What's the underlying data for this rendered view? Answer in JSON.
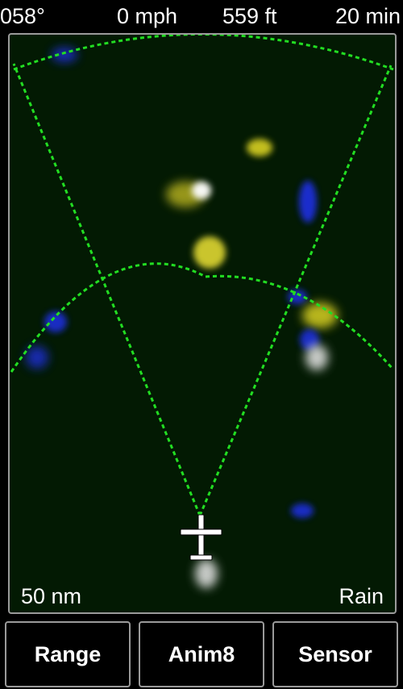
{
  "status": {
    "heading": "058°",
    "speed": "0 mph",
    "altitude": "559 ft",
    "time": "20 min"
  },
  "radar": {
    "range_label": "50 nm",
    "product_label": "Rain",
    "ring_color": "#22dd22",
    "background_color": "#031a03",
    "precip_colors": {
      "light": "#1a2fd8",
      "moderate": "#d8d020",
      "heavy": "#ffffff"
    }
  },
  "buttons": {
    "range": "Range",
    "animate": "Anim8",
    "sensor": "Sensor"
  }
}
